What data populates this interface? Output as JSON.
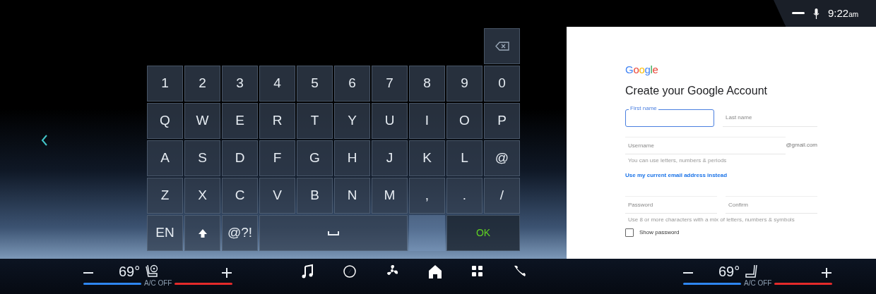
{
  "status_bar": {
    "time": "9:22",
    "meridiem": "am"
  },
  "keyboard": {
    "rows": [
      [
        {
          "kind": "backspace"
        }
      ],
      [
        {
          "kind": "char",
          "label": "1"
        },
        {
          "kind": "char",
          "label": "2"
        },
        {
          "kind": "char",
          "label": "3"
        },
        {
          "kind": "char",
          "label": "4"
        },
        {
          "kind": "char",
          "label": "5"
        },
        {
          "kind": "char",
          "label": "6"
        },
        {
          "kind": "char",
          "label": "7"
        },
        {
          "kind": "char",
          "label": "8"
        },
        {
          "kind": "char",
          "label": "9"
        },
        {
          "kind": "char",
          "label": "0"
        }
      ],
      [
        {
          "kind": "char",
          "label": "Q"
        },
        {
          "kind": "char",
          "label": "W"
        },
        {
          "kind": "char",
          "label": "E"
        },
        {
          "kind": "char",
          "label": "R"
        },
        {
          "kind": "char",
          "label": "T"
        },
        {
          "kind": "char",
          "label": "Y"
        },
        {
          "kind": "char",
          "label": "U"
        },
        {
          "kind": "char",
          "label": "I"
        },
        {
          "kind": "char",
          "label": "O"
        },
        {
          "kind": "char",
          "label": "P"
        }
      ],
      [
        {
          "kind": "char",
          "label": "A"
        },
        {
          "kind": "char",
          "label": "S"
        },
        {
          "kind": "char",
          "label": "D"
        },
        {
          "kind": "char",
          "label": "F"
        },
        {
          "kind": "char",
          "label": "G"
        },
        {
          "kind": "char",
          "label": "H"
        },
        {
          "kind": "char",
          "label": "J"
        },
        {
          "kind": "char",
          "label": "K"
        },
        {
          "kind": "char",
          "label": "L"
        },
        {
          "kind": "char",
          "label": "@"
        }
      ],
      [
        {
          "kind": "char",
          "label": "Z"
        },
        {
          "kind": "char",
          "label": "X"
        },
        {
          "kind": "char",
          "label": "C"
        },
        {
          "kind": "char",
          "label": "V"
        },
        {
          "kind": "char",
          "label": "B"
        },
        {
          "kind": "char",
          "label": "N"
        },
        {
          "kind": "char",
          "label": "M"
        },
        {
          "kind": "char",
          "label": ","
        },
        {
          "kind": "char",
          "label": "."
        },
        {
          "kind": "char",
          "label": "/"
        }
      ],
      [
        {
          "kind": "char",
          "label": "EN"
        },
        {
          "kind": "shift"
        },
        {
          "kind": "char",
          "label": "@?!"
        },
        {
          "kind": "space"
        },
        {
          "kind": "blank"
        },
        {
          "kind": "ok",
          "label": "OK"
        }
      ]
    ]
  },
  "form": {
    "logo": "Google",
    "title": "Create your Google Account",
    "first_name": {
      "label": "First name",
      "focused": true
    },
    "last_name": {
      "placeholder": "Last name"
    },
    "username": {
      "placeholder": "Username",
      "suffix": "@gmail.com",
      "hint": "You can use letters, numbers & periods"
    },
    "link": "Use my current email address instead",
    "password": {
      "placeholder": "Password"
    },
    "confirm": {
      "placeholder": "Confirm"
    },
    "password_hint": "Use 8 or more characters with a mix of letters, numbers & symbols",
    "show_password": {
      "label": "Show password",
      "checked": false
    }
  },
  "climate": [
    {
      "temperature": "69°",
      "kind": "heated_seat",
      "ac": "A/C OFF"
    },
    {
      "temperature": "69°",
      "kind": "seat",
      "ac": "A/C OFF"
    }
  ],
  "dock": [
    {
      "kind": "music"
    },
    {
      "kind": "navigation"
    },
    {
      "kind": "fan"
    },
    {
      "kind": "home"
    },
    {
      "kind": "apps"
    },
    {
      "kind": "phone"
    }
  ]
}
